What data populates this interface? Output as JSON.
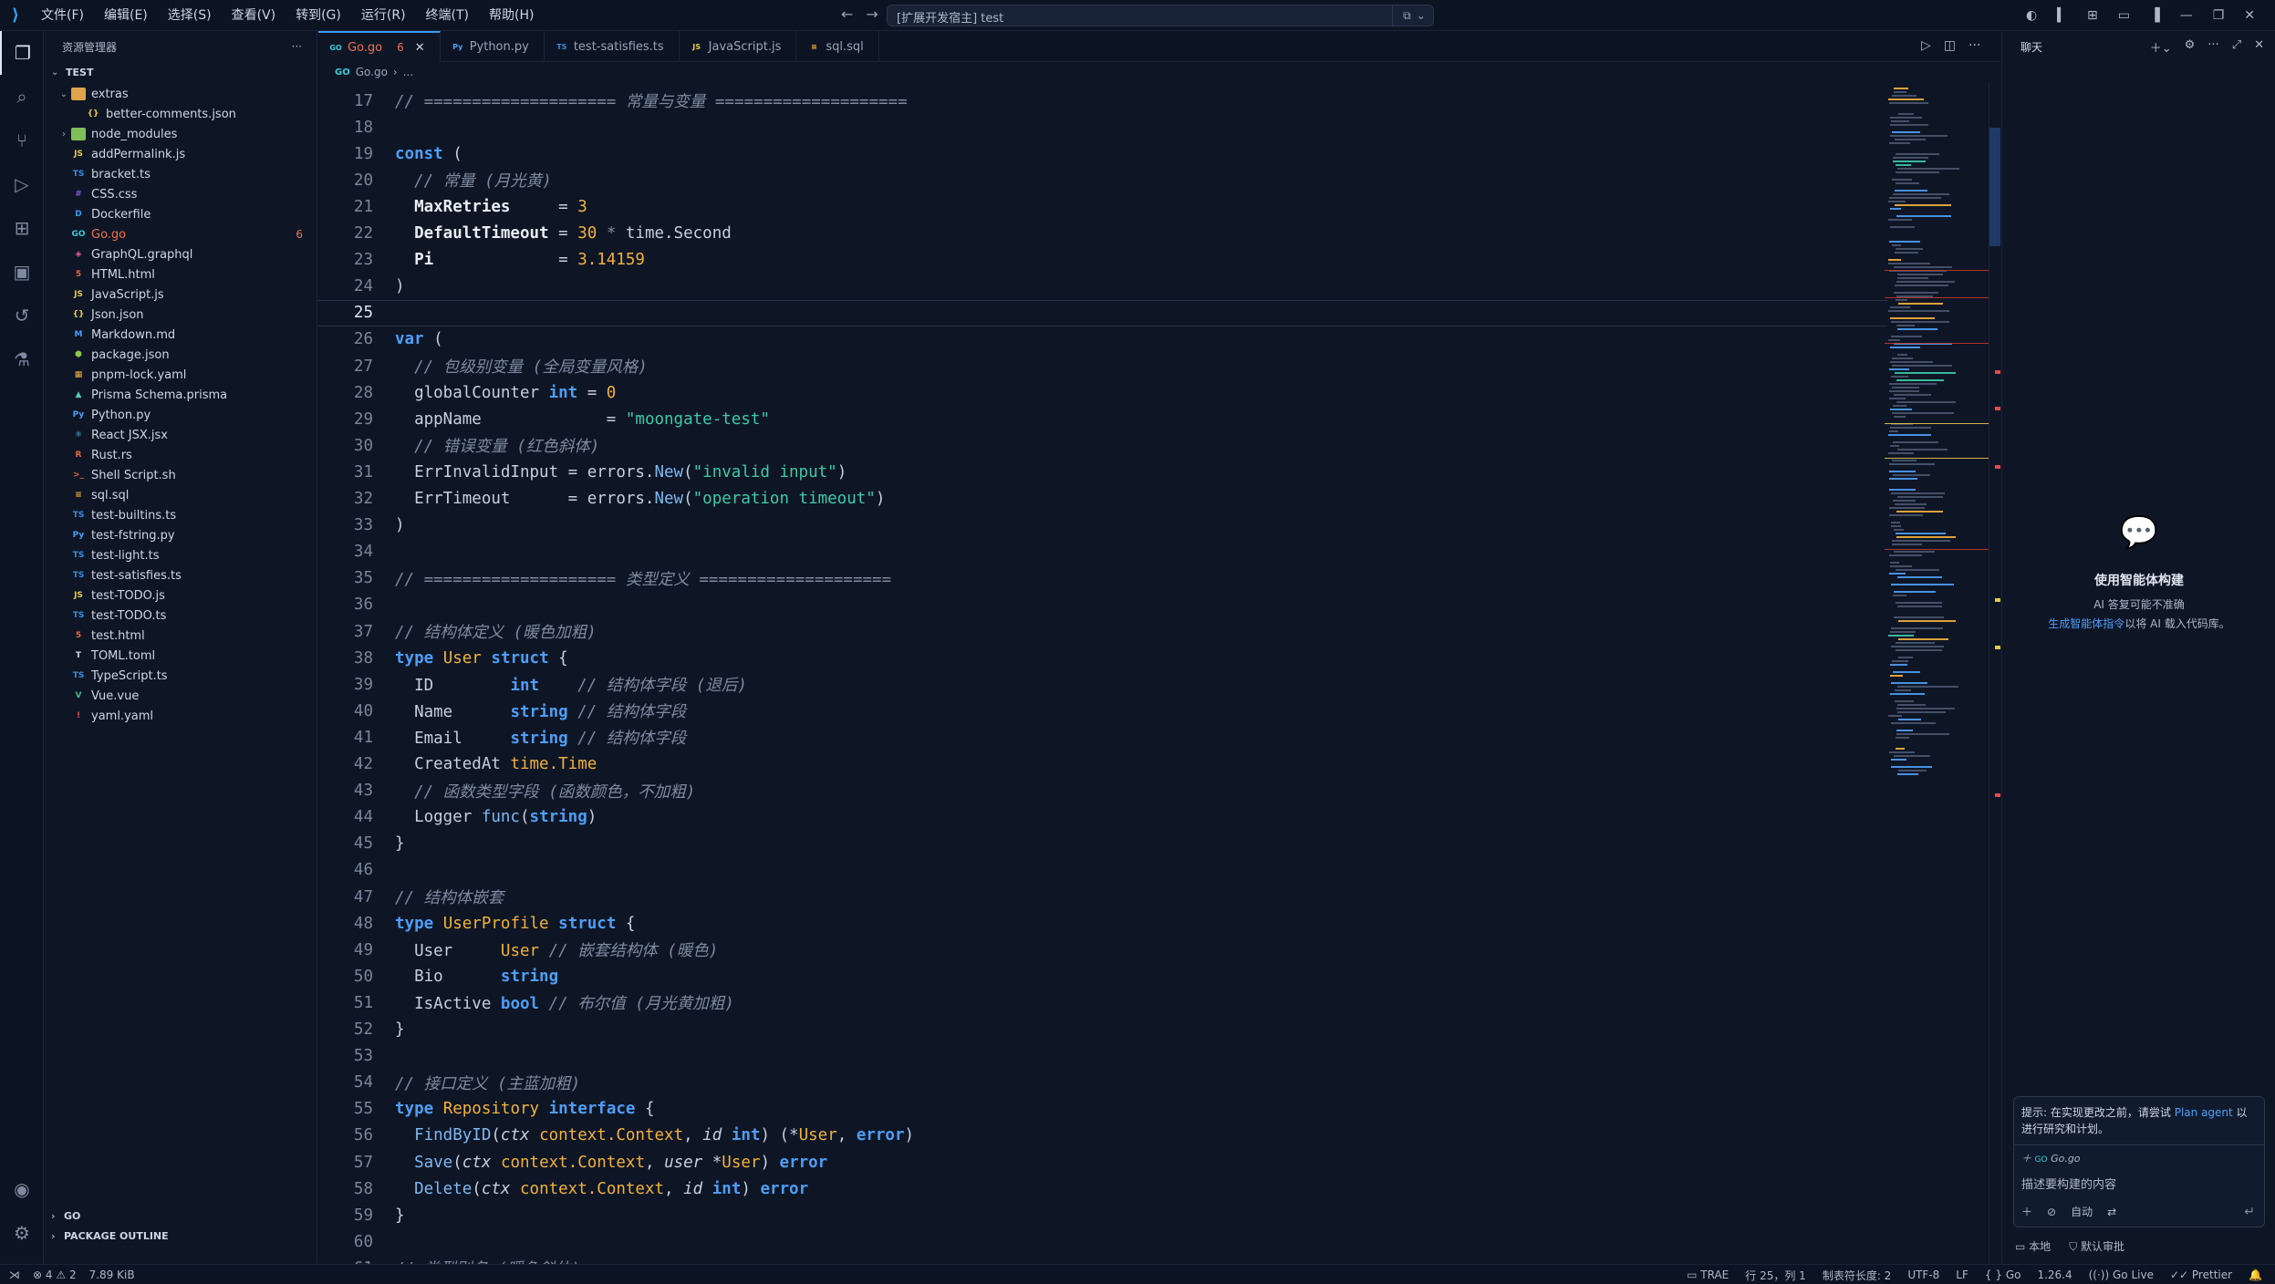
{
  "menus": [
    "文件(F)",
    "编辑(E)",
    "选择(S)",
    "查看(V)",
    "转到(G)",
    "运行(R)",
    "终端(T)",
    "帮助(H)"
  ],
  "search": {
    "text": "[扩展开发宿主] test"
  },
  "sidebar": {
    "title": "资源管理器",
    "root": "TEST",
    "items": [
      {
        "label": "extras",
        "type": "folder-open",
        "level": 0,
        "icon_color": "#e0a24a"
      },
      {
        "label": "better-comments.json",
        "type": "file",
        "level": 1,
        "icon": "{}",
        "icon_color": "#e6c84b"
      },
      {
        "label": "node_modules",
        "type": "folder",
        "level": 0,
        "icon_color": "#7fbf5a"
      },
      {
        "label": "addPermalink.js",
        "type": "file",
        "level": 0,
        "icon": "JS",
        "icon_color": "#e6c84b"
      },
      {
        "label": "bracket.ts",
        "type": "file",
        "level": 0,
        "icon": "TS",
        "icon_color": "#3b8de0"
      },
      {
        "label": "CSS.css",
        "type": "file",
        "level": 0,
        "icon": "#",
        "icon_color": "#7e5cd6"
      },
      {
        "label": "Dockerfile",
        "type": "file",
        "level": 0,
        "icon": "D",
        "icon_color": "#3b9cf0"
      },
      {
        "label": "Go.go",
        "type": "file",
        "level": 0,
        "icon": "GO",
        "icon_color": "#3ec9d6",
        "error": true,
        "badge": "6"
      },
      {
        "label": "GraphQL.graphql",
        "type": "file",
        "level": 0,
        "icon": "◈",
        "icon_color": "#e35ba0"
      },
      {
        "label": "HTML.html",
        "type": "file",
        "level": 0,
        "icon": "5",
        "icon_color": "#e8663c"
      },
      {
        "label": "JavaScript.js",
        "type": "file",
        "level": 0,
        "icon": "JS",
        "icon_color": "#e6c84b"
      },
      {
        "label": "Json.json",
        "type": "file",
        "level": 0,
        "icon": "{}",
        "icon_color": "#e6c84b"
      },
      {
        "label": "Markdown.md",
        "type": "file",
        "level": 0,
        "icon": "M",
        "icon_color": "#4f9ef6"
      },
      {
        "label": "package.json",
        "type": "file",
        "level": 0,
        "icon": "⬢",
        "icon_color": "#8cc84b"
      },
      {
        "label": "pnpm-lock.yaml",
        "type": "file",
        "level": 0,
        "icon": "▦",
        "icon_color": "#f2b13c"
      },
      {
        "label": "Prisma Schema.prisma",
        "type": "file",
        "level": 0,
        "icon": "▲",
        "icon_color": "#5ac8b4"
      },
      {
        "label": "Python.py",
        "type": "file",
        "level": 0,
        "icon": "Py",
        "icon_color": "#4f9ef6"
      },
      {
        "label": "React JSX.jsx",
        "type": "file",
        "level": 0,
        "icon": "⚛",
        "icon_color": "#5ad4f0"
      },
      {
        "label": "Rust.rs",
        "type": "file",
        "level": 0,
        "icon": "R",
        "icon_color": "#e8663c"
      },
      {
        "label": "Shell Script.sh",
        "type": "file",
        "level": 0,
        "icon": ">_",
        "icon_color": "#e8663c"
      },
      {
        "label": "sql.sql",
        "type": "file",
        "level": 0,
        "icon": "≡",
        "icon_color": "#f2b13c"
      },
      {
        "label": "test-builtins.ts",
        "type": "file",
        "level": 0,
        "icon": "TS",
        "icon_color": "#3b8de0"
      },
      {
        "label": "test-fstring.py",
        "type": "file",
        "level": 0,
        "icon": "Py",
        "icon_color": "#4f9ef6"
      },
      {
        "label": "test-light.ts",
        "type": "file",
        "level": 0,
        "icon": "TS",
        "icon_color": "#3b8de0"
      },
      {
        "label": "test-satisfies.ts",
        "type": "file",
        "level": 0,
        "icon": "TS",
        "icon_color": "#3b8de0"
      },
      {
        "label": "test-TODO.js",
        "type": "file",
        "level": 0,
        "icon": "JS",
        "icon_color": "#e6c84b"
      },
      {
        "label": "test-TODO.ts",
        "type": "file",
        "level": 0,
        "icon": "TS",
        "icon_color": "#3b8de0"
      },
      {
        "label": "test.html",
        "type": "file",
        "level": 0,
        "icon": "5",
        "icon_color": "#e8663c"
      },
      {
        "label": "TOML.toml",
        "type": "file",
        "level": 0,
        "icon": "T",
        "icon_color": "#cfd6e2"
      },
      {
        "label": "TypeScript.ts",
        "type": "file",
        "level": 0,
        "icon": "TS",
        "icon_color": "#3b8de0"
      },
      {
        "label": "Vue.vue",
        "type": "file",
        "level": 0,
        "icon": "V",
        "icon_color": "#41b883"
      },
      {
        "label": "yaml.yaml",
        "type": "file",
        "level": 0,
        "icon": "!",
        "icon_color": "#e84a4a"
      }
    ],
    "sections": [
      "GO",
      "PACKAGE OUTLINE"
    ]
  },
  "tabs": [
    {
      "label": "Go.go",
      "icon": "GO",
      "icon_color": "#3ec9d6",
      "active": true,
      "count": "6"
    },
    {
      "label": "Python.py",
      "icon": "Py",
      "icon_color": "#4f9ef6"
    },
    {
      "label": "test-satisfies.ts",
      "icon": "TS",
      "icon_color": "#3b8de0"
    },
    {
      "label": "JavaScript.js",
      "icon": "JS",
      "icon_color": "#e6c84b"
    },
    {
      "label": "sql.sql",
      "icon": "≡",
      "icon_color": "#f2b13c"
    }
  ],
  "breadcrumb": [
    "Go.go",
    "..."
  ],
  "code": {
    "current_line": 25,
    "lines": [
      {
        "n": "17",
        "segs": [
          [
            "c",
            "// ==================== 常量与变量 ===================="
          ]
        ]
      },
      {
        "n": "18",
        "segs": []
      },
      {
        "n": "19",
        "segs": [
          [
            "k",
            "const"
          ],
          [
            "",
            " ("
          ]
        ]
      },
      {
        "n": "20",
        "segs": [
          [
            "",
            "  "
          ],
          [
            "c",
            "// 常量 (月光黄)"
          ]
        ]
      },
      {
        "n": "21",
        "segs": [
          [
            "",
            "  "
          ],
          [
            "b",
            "MaxRetries"
          ],
          [
            "",
            "     = "
          ],
          [
            "n",
            "3"
          ]
        ]
      },
      {
        "n": "22",
        "segs": [
          [
            "",
            "  "
          ],
          [
            "b",
            "DefaultTimeout"
          ],
          [
            "",
            " = "
          ],
          [
            "n",
            "30"
          ],
          [
            "o",
            " * "
          ],
          [
            "",
            "time.Second"
          ]
        ]
      },
      {
        "n": "23",
        "segs": [
          [
            "",
            "  "
          ],
          [
            "b",
            "Pi"
          ],
          [
            "",
            "             = "
          ],
          [
            "n",
            "3.14159"
          ]
        ]
      },
      {
        "n": "24",
        "segs": [
          [
            "",
            ")"
          ]
        ]
      },
      {
        "n": "25",
        "segs": []
      },
      {
        "n": "26",
        "segs": [
          [
            "k",
            "var"
          ],
          [
            "",
            " ("
          ]
        ]
      },
      {
        "n": "27",
        "segs": [
          [
            "",
            "  "
          ],
          [
            "c",
            "// 包级别变量 (全局变量风格)"
          ]
        ]
      },
      {
        "n": "28",
        "segs": [
          [
            "",
            "  globalCounter "
          ],
          [
            "k",
            "int"
          ],
          [
            "",
            " = "
          ],
          [
            "n",
            "0"
          ]
        ]
      },
      {
        "n": "29",
        "segs": [
          [
            "",
            "  appName             = "
          ],
          [
            "s",
            "\"moongate-test\""
          ]
        ]
      },
      {
        "n": "30",
        "segs": [
          [
            "",
            "  "
          ],
          [
            "c",
            "// 错误变量 (红色斜体)"
          ]
        ]
      },
      {
        "n": "31",
        "segs": [
          [
            "",
            "  ErrInvalidInput = errors."
          ],
          [
            "f",
            "New"
          ],
          [
            "",
            "("
          ],
          [
            "s",
            "\"invalid input\""
          ],
          [
            "",
            ")"
          ]
        ]
      },
      {
        "n": "32",
        "segs": [
          [
            "",
            "  ErrTimeout      = errors."
          ],
          [
            "f",
            "New"
          ],
          [
            "",
            "("
          ],
          [
            "s",
            "\"operation timeout\""
          ],
          [
            "",
            ")"
          ]
        ]
      },
      {
        "n": "33",
        "segs": [
          [
            "",
            ")"
          ]
        ]
      },
      {
        "n": "34",
        "segs": []
      },
      {
        "n": "35",
        "segs": [
          [
            "c",
            "// ==================== 类型定义 ===================="
          ]
        ]
      },
      {
        "n": "36",
        "segs": []
      },
      {
        "n": "37",
        "segs": [
          [
            "c",
            "// 结构体定义 (暖色加粗)"
          ]
        ]
      },
      {
        "n": "38",
        "segs": [
          [
            "k",
            "type"
          ],
          [
            "",
            " "
          ],
          [
            "t",
            "User"
          ],
          [
            "",
            " "
          ],
          [
            "k",
            "struct"
          ],
          [
            "",
            " {"
          ]
        ]
      },
      {
        "n": "39",
        "segs": [
          [
            "",
            "  ID        "
          ],
          [
            "k",
            "int"
          ],
          [
            "",
            "    "
          ],
          [
            "c",
            "// 结构体字段 (退后)"
          ]
        ]
      },
      {
        "n": "40",
        "segs": [
          [
            "",
            "  Name      "
          ],
          [
            "k",
            "string"
          ],
          [
            "",
            " "
          ],
          [
            "c",
            "// 结构体字段"
          ]
        ]
      },
      {
        "n": "41",
        "segs": [
          [
            "",
            "  Email     "
          ],
          [
            "k",
            "string"
          ],
          [
            "",
            " "
          ],
          [
            "c",
            "// 结构体字段"
          ]
        ]
      },
      {
        "n": "42",
        "segs": [
          [
            "",
            "  CreatedAt "
          ],
          [
            "t",
            "time.Time"
          ]
        ]
      },
      {
        "n": "43",
        "segs": [
          [
            "",
            "  "
          ],
          [
            "c",
            "// 函数类型字段 (函数颜色，不加粗)"
          ]
        ]
      },
      {
        "n": "44",
        "segs": [
          [
            "",
            "  Logger "
          ],
          [
            "f",
            "func"
          ],
          [
            "",
            "("
          ],
          [
            "k",
            "string"
          ],
          [
            "",
            ")"
          ]
        ]
      },
      {
        "n": "45",
        "segs": [
          [
            "",
            "}"
          ]
        ]
      },
      {
        "n": "46",
        "segs": []
      },
      {
        "n": "47",
        "segs": [
          [
            "c",
            "// 结构体嵌套"
          ]
        ]
      },
      {
        "n": "48",
        "segs": [
          [
            "k",
            "type"
          ],
          [
            "",
            " "
          ],
          [
            "t",
            "UserProfile"
          ],
          [
            "",
            " "
          ],
          [
            "k",
            "struct"
          ],
          [
            "",
            " {"
          ]
        ]
      },
      {
        "n": "49",
        "segs": [
          [
            "",
            "  User     "
          ],
          [
            "t",
            "User"
          ],
          [
            "",
            " "
          ],
          [
            "c",
            "// 嵌套结构体 (暖色)"
          ]
        ]
      },
      {
        "n": "50",
        "segs": [
          [
            "",
            "  Bio      "
          ],
          [
            "k",
            "string"
          ]
        ]
      },
      {
        "n": "51",
        "segs": [
          [
            "",
            "  IsActive "
          ],
          [
            "k",
            "bool"
          ],
          [
            "",
            " "
          ],
          [
            "c",
            "// 布尔值 (月光黄加粗)"
          ]
        ]
      },
      {
        "n": "52",
        "segs": [
          [
            "",
            "}"
          ]
        ]
      },
      {
        "n": "53",
        "segs": []
      },
      {
        "n": "54",
        "segs": [
          [
            "c",
            "// 接口定义 (主蓝加粗)"
          ]
        ]
      },
      {
        "n": "55",
        "segs": [
          [
            "k",
            "type"
          ],
          [
            "",
            " "
          ],
          [
            "t",
            "Repository"
          ],
          [
            "",
            " "
          ],
          [
            "k",
            "interface"
          ],
          [
            "",
            " {"
          ]
        ]
      },
      {
        "n": "56",
        "segs": [
          [
            "",
            "  "
          ],
          [
            "f",
            "FindByID"
          ],
          [
            "",
            "("
          ],
          [
            "p",
            "ctx"
          ],
          [
            "",
            " "
          ],
          [
            "t",
            "context.Context"
          ],
          [
            "",
            ", "
          ],
          [
            "p",
            "id"
          ],
          [
            "",
            " "
          ],
          [
            "k",
            "int"
          ],
          [
            "",
            ") (*"
          ],
          [
            "t",
            "User"
          ],
          [
            "",
            ", "
          ],
          [
            "k",
            "error"
          ],
          [
            "",
            ")"
          ]
        ]
      },
      {
        "n": "57",
        "segs": [
          [
            "",
            "  "
          ],
          [
            "f",
            "Save"
          ],
          [
            "",
            "("
          ],
          [
            "p",
            "ctx"
          ],
          [
            "",
            " "
          ],
          [
            "t",
            "context.Context"
          ],
          [
            "",
            ", "
          ],
          [
            "p",
            "user"
          ],
          [
            "",
            " *"
          ],
          [
            "t",
            "User"
          ],
          [
            "",
            ") "
          ],
          [
            "k",
            "error"
          ]
        ]
      },
      {
        "n": "58",
        "segs": [
          [
            "",
            "  "
          ],
          [
            "f",
            "Delete"
          ],
          [
            "",
            "("
          ],
          [
            "p",
            "ctx"
          ],
          [
            "",
            " "
          ],
          [
            "t",
            "context.Context"
          ],
          [
            "",
            ", "
          ],
          [
            "p",
            "id"
          ],
          [
            "",
            " "
          ],
          [
            "k",
            "int"
          ],
          [
            "",
            ") "
          ],
          [
            "k",
            "error"
          ]
        ]
      },
      {
        "n": "59",
        "segs": [
          [
            "",
            "}"
          ]
        ]
      },
      {
        "n": "60",
        "segs": []
      },
      {
        "n": "61",
        "segs": [
          [
            "c",
            "// 类型别名 (暖色斜体)"
          ]
        ]
      }
    ]
  },
  "chat": {
    "title": "聊天",
    "empty_title": "使用智能体构建",
    "empty_sub": "AI 答复可能不准确",
    "empty_link": "生成智能体指令",
    "empty_link_suffix": "以将 AI 载入代码库。",
    "tip_prefix": "提示: 在实现更改之前，请尝试 ",
    "tip_link": "Plan agent",
    "tip_suffix": " 以进行研究和计划。",
    "context_file": "Go.go",
    "placeholder": "描述要构建的内容",
    "mode": "自动",
    "footer_left": "本地",
    "footer_right": "默认审批"
  },
  "status": {
    "errors": "4",
    "warnings": "2",
    "size": "7.89 KiB",
    "trae": "TRAE",
    "position": "行 25，列 1",
    "tab_size": "制表符长度: 2",
    "encoding": "UTF-8",
    "eol": "LF",
    "language": "Go",
    "version": "1.26.4",
    "go_live": "Go Live",
    "prettier": "Prettier"
  }
}
